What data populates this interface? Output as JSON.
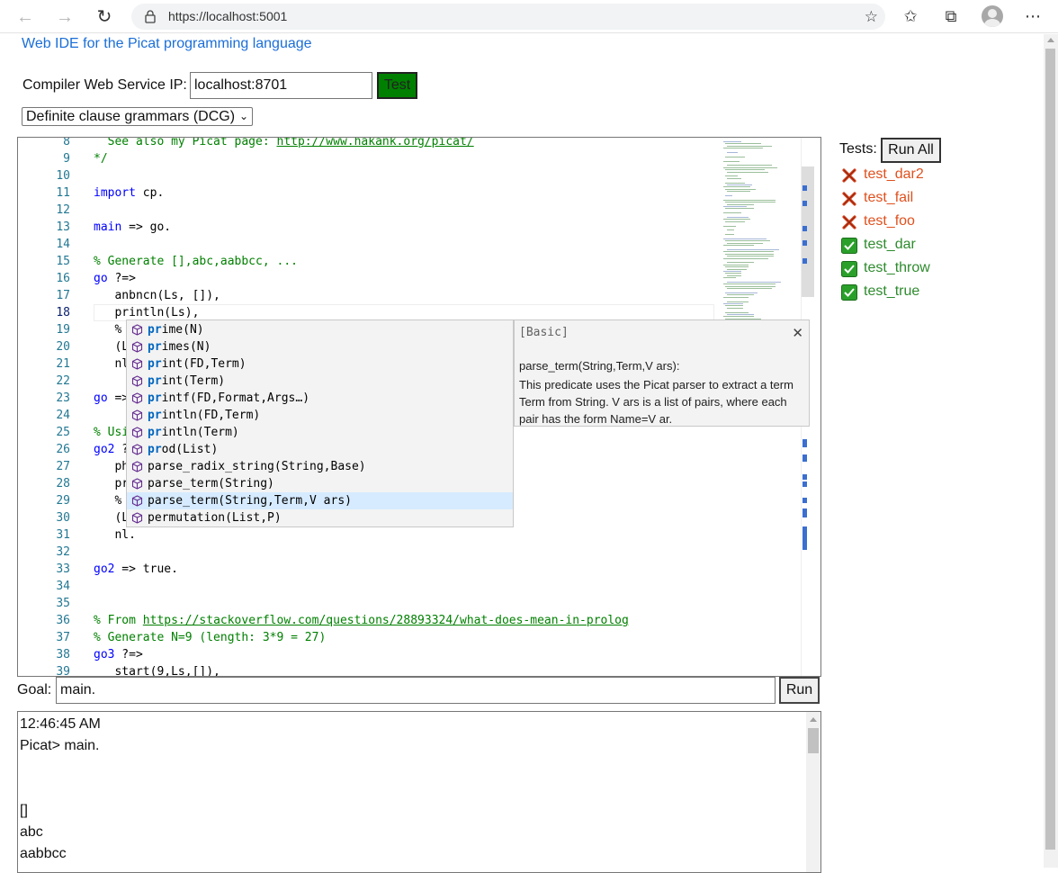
{
  "browser": {
    "url": "https://localhost:5001",
    "icons": [
      "back-icon",
      "forward-icon",
      "refresh-icon",
      "lock-icon",
      "add-favorite-icon",
      "favorites-icon",
      "collections-icon",
      "profile-icon",
      "more-icon"
    ]
  },
  "page": {
    "title": "Web IDE for the Picat programming language",
    "ip_label": "Compiler Web Service IP:",
    "ip_value": "localhost:8701",
    "test_label": "Test",
    "test_color": "#008000",
    "example_selected": "Definite clause grammars (DCG)"
  },
  "editor": {
    "lines": [
      {
        "n": "8",
        "parts": [
          [
            "com",
            "  See also my Picat page: "
          ],
          [
            "link",
            "http://www.hakank.org/picat/"
          ]
        ]
      },
      {
        "n": "9",
        "parts": [
          [
            "com",
            "*/"
          ]
        ]
      },
      {
        "n": "10",
        "parts": []
      },
      {
        "n": "11",
        "parts": [
          [
            "kw",
            "import"
          ],
          [
            "txt",
            " cp."
          ]
        ]
      },
      {
        "n": "12",
        "parts": []
      },
      {
        "n": "13",
        "parts": [
          [
            "kw",
            "main"
          ],
          [
            "txt",
            " => go."
          ]
        ]
      },
      {
        "n": "14",
        "parts": []
      },
      {
        "n": "15",
        "parts": [
          [
            "com",
            "% Generate [],abc,aabbcc, ..."
          ]
        ]
      },
      {
        "n": "16",
        "parts": [
          [
            "kw",
            "go"
          ],
          [
            "txt",
            " ?=>"
          ]
        ]
      },
      {
        "n": "17",
        "parts": [
          [
            "txt",
            "   anbncn(Ls, []),"
          ]
        ]
      },
      {
        "n": "18",
        "parts": [
          [
            "txt",
            "   println(Ls),"
          ]
        ]
      },
      {
        "n": "19",
        "parts": [
          [
            "txt",
            "   %"
          ]
        ]
      },
      {
        "n": "20",
        "parts": [
          [
            "txt",
            "   (L"
          ]
        ]
      },
      {
        "n": "21",
        "parts": [
          [
            "txt",
            "   nl"
          ]
        ]
      },
      {
        "n": "22",
        "parts": []
      },
      {
        "n": "23",
        "parts": [
          [
            "kw",
            "go"
          ],
          [
            "txt",
            " =>"
          ]
        ]
      },
      {
        "n": "24",
        "parts": []
      },
      {
        "n": "25",
        "parts": [
          [
            "com",
            "% Usi"
          ]
        ]
      },
      {
        "n": "26",
        "parts": [
          [
            "kw",
            "go2"
          ],
          [
            "txt",
            " ?"
          ]
        ]
      },
      {
        "n": "27",
        "parts": [
          [
            "txt",
            "   ph"
          ]
        ]
      },
      {
        "n": "28",
        "parts": [
          [
            "txt",
            "   pr"
          ]
        ]
      },
      {
        "n": "29",
        "parts": [
          [
            "txt",
            "   %"
          ]
        ]
      },
      {
        "n": "30",
        "parts": [
          [
            "txt",
            "   (L"
          ]
        ]
      },
      {
        "n": "31",
        "parts": [
          [
            "txt",
            "   nl."
          ]
        ]
      },
      {
        "n": "32",
        "parts": []
      },
      {
        "n": "33",
        "parts": [
          [
            "kw",
            "go2"
          ],
          [
            "txt",
            " => true."
          ]
        ]
      },
      {
        "n": "34",
        "parts": []
      },
      {
        "n": "35",
        "parts": []
      },
      {
        "n": "36",
        "parts": [
          [
            "com",
            "% From "
          ],
          [
            "link",
            "https://stackoverflow.com/questions/28893324/what-does-mean-in-prolog"
          ]
        ]
      },
      {
        "n": "37",
        "parts": [
          [
            "com",
            "% Generate N=9 (length: 3*9 = 27)"
          ]
        ]
      },
      {
        "n": "38",
        "parts": [
          [
            "kw",
            "go3"
          ],
          [
            "txt",
            " ?=>"
          ]
        ]
      },
      {
        "n": "39",
        "parts": [
          [
            "txt",
            "   start(9,Ls,[]),"
          ]
        ]
      }
    ],
    "current_line": "18"
  },
  "suggest": {
    "items": [
      {
        "hl": "pr",
        "rest": "ime(N)"
      },
      {
        "hl": "pr",
        "rest": "imes(N)"
      },
      {
        "hl": "pr",
        "rest": "int(FD,Term)"
      },
      {
        "hl": "pr",
        "rest": "int(Term)"
      },
      {
        "hl": "pr",
        "rest": "intf(FD,Format,Args…)"
      },
      {
        "hl": "pr",
        "rest": "intln(FD,Term)"
      },
      {
        "hl": "pr",
        "rest": "intln(Term)"
      },
      {
        "hl": "pr",
        "rest": "od(List)"
      },
      {
        "hl": "",
        "rest": "parse_radix_string(String,Base)"
      },
      {
        "hl": "",
        "rest": "parse_term(String)"
      },
      {
        "hl": "",
        "rest": "parse_term(String,Term,V ars)"
      },
      {
        "hl": "",
        "rest": "permutation(List,P)"
      }
    ],
    "selected_index": 10,
    "details_tag": "[Basic]",
    "details_signature": "parse_term(String,Term,V ars):",
    "details_description": "This predicate uses the Picat parser to extract a term Term from String. V ars is a list of pairs, where each pair has the form Name=V ar."
  },
  "tests": {
    "label": "Tests:",
    "run_all_label": "Run All",
    "items": [
      {
        "name": "test_dar2",
        "status": "fail"
      },
      {
        "name": "test_fail",
        "status": "fail"
      },
      {
        "name": "test_foo",
        "status": "fail"
      },
      {
        "name": "test_dar",
        "status": "pass"
      },
      {
        "name": "test_throw",
        "status": "pass"
      },
      {
        "name": "test_true",
        "status": "pass"
      }
    ],
    "fail_color": "#e0501e",
    "pass_color": "#2e8b2e"
  },
  "goal": {
    "label": "Goal:",
    "value": "main.",
    "run_label": "Run"
  },
  "output": {
    "lines": [
      "12:46:45 AM",
      "Picat> main.",
      "",
      "",
      "[]",
      "abc",
      "aabbcc"
    ]
  }
}
